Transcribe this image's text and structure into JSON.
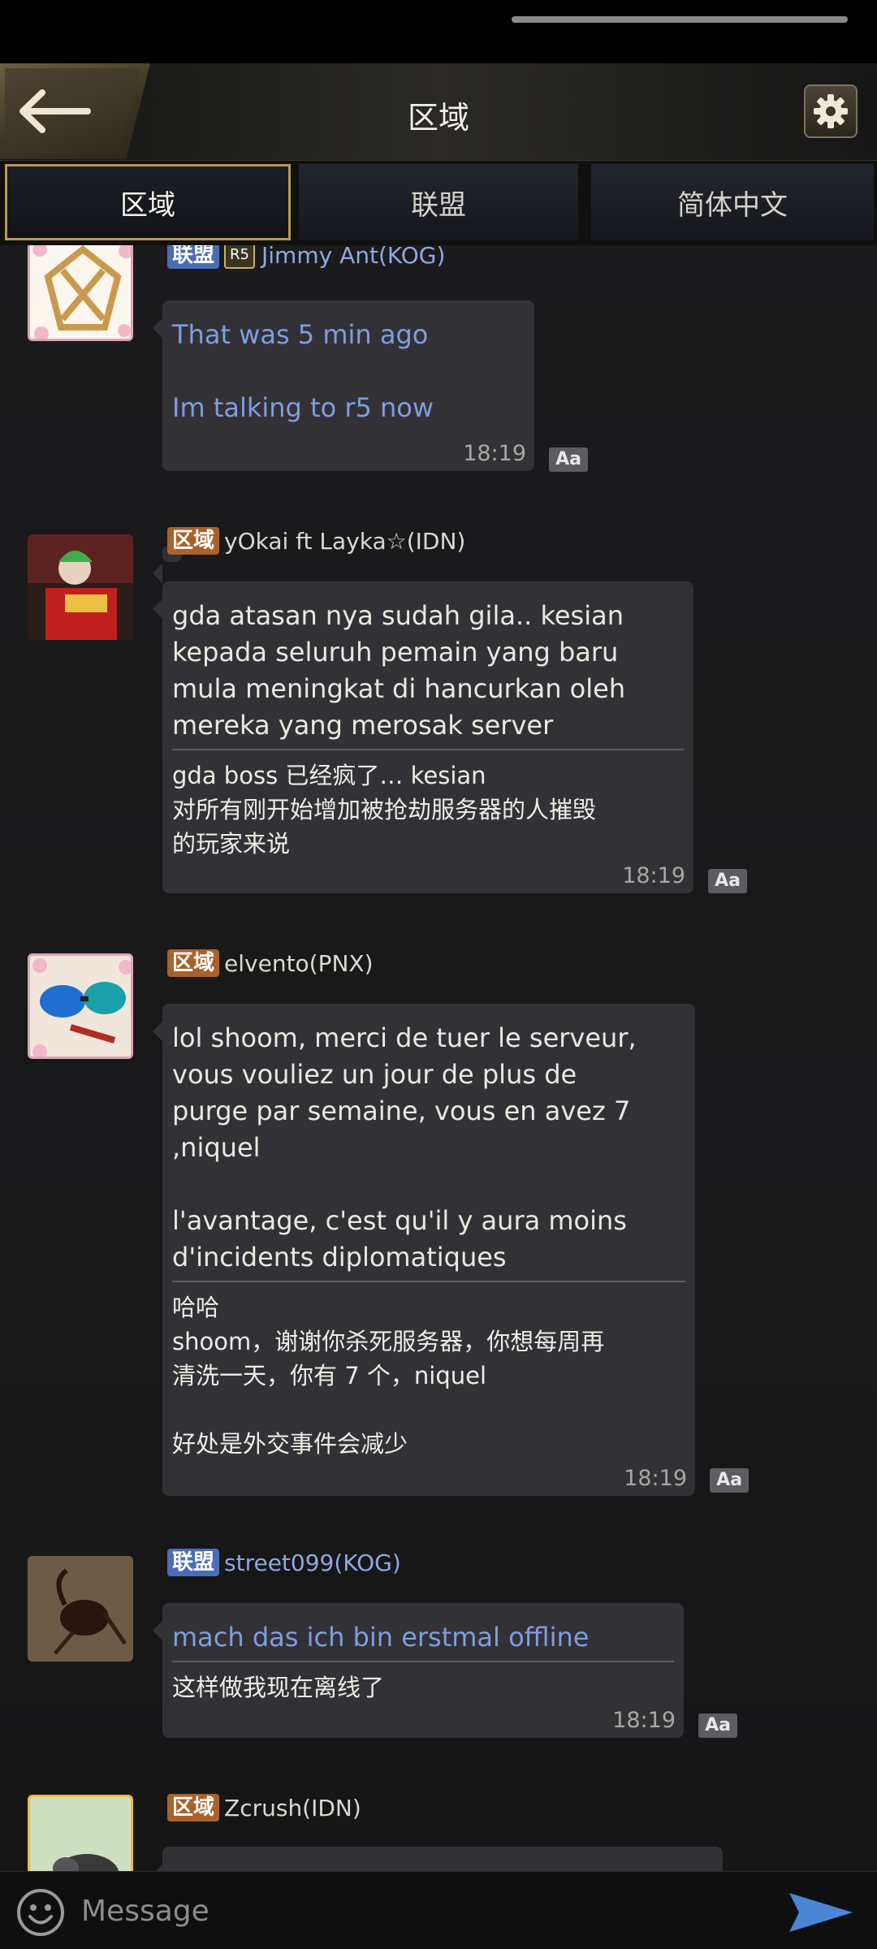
{
  "header": {
    "title": "区域"
  },
  "tabs": [
    {
      "label": "区域",
      "active": true
    },
    {
      "label": "联盟",
      "active": false
    },
    {
      "label": "简体中文",
      "active": false
    }
  ],
  "messages": [
    {
      "badge": "联盟",
      "badge_type": "alliance",
      "rank": "R5",
      "sender": "Jimmy Ant(KOG)",
      "text": "That was 5 min ago\n\nIm talking to r5 now",
      "translation": "",
      "time": "18:19",
      "text_color": "blue"
    },
    {
      "badge": "区域",
      "badge_type": "region",
      "sender": "yOkai ft Layka☆(IDN)",
      "text": "gda atasan nya sudah gila.. kesian\nkepada seluruh pemain yang baru\nmula meningkat di hancurkan oleh\nmereka yang merosak server",
      "translation": "gda boss 已经疯了… kesian\n对所有刚开始增加被抢劫服务器的人摧毁\n的玩家来说",
      "time": "18:19"
    },
    {
      "badge": "区域",
      "badge_type": "region",
      "sender": "elvento(PNX)",
      "text": "lol shoom, merci de tuer le serveur,\nvous vouliez un jour de plus de\npurge par semaine, vous en avez 7\n,niquel\n\nl'avantage, c'est qu'il y aura moins\nd'incidents diplomatiques",
      "translation": "哈哈\nshoom，谢谢你杀死服务器，你想每周再\n清洗一天，你有 7 个，niquel\n\n好处是外交事件会减少",
      "time": "18:19"
    },
    {
      "badge": "联盟",
      "badge_type": "alliance",
      "sender": "street099(KOG)",
      "text": "mach das ich bin erstmal offline",
      "translation": "这样做我现在离线了",
      "time": "18:19",
      "text_color": "blue"
    },
    {
      "badge": "区域",
      "badge_type": "region",
      "sender": "Zcrush(IDN)"
    }
  ],
  "translate_toggle_label": "Aa",
  "input": {
    "placeholder": "Message"
  },
  "colors": {
    "accent_gold": "#b59a58",
    "region_badge": "#a8622a",
    "alliance_badge": "#4b6cb7",
    "alliance_text": "#7f9de0"
  }
}
